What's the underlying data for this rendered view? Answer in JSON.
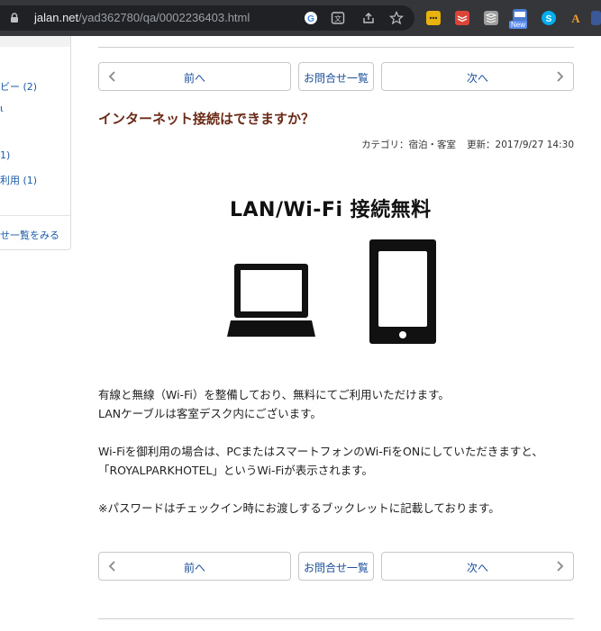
{
  "browser": {
    "url_host": "jalan.net",
    "url_path": "/yad362780/qa/0002236403.html",
    "extension_badge": "New"
  },
  "sidebar": {
    "links": [
      "ビー (2)",
      "ι",
      "1)",
      "利用 (1)",
      "せ一覧をみる"
    ]
  },
  "nav": {
    "prev_label": "前へ",
    "list_label": "お問合せ一覧",
    "next_label": "次へ"
  },
  "question": {
    "title": "インターネット接続はできますか？",
    "category": "カテゴリ：宿泊・客室",
    "updated": "更新：2017/9/27 14:30"
  },
  "image": {
    "heading": "LAN/Wi-Fi  接続無料"
  },
  "answer": {
    "lines": [
      "有線と無線（Wi-Fi）を整備しており、無料にてご利用いただけます。",
      "LANケーブルは客室デスク内にございます。",
      "",
      "Wi-Fiを御利用の場合は、PCまたはスマートフォンのWi-FiをONにしていただきますと、",
      "「ROYALPARKHOTEL」というWi-Fiが表示されます。",
      "",
      "※パスワードはチェックイン時にお渡しするブックレットに記載しております。"
    ]
  },
  "colors": {
    "title": "#6b2a17",
    "link": "#1a4f9c",
    "chrome_bar": "#35363a"
  }
}
